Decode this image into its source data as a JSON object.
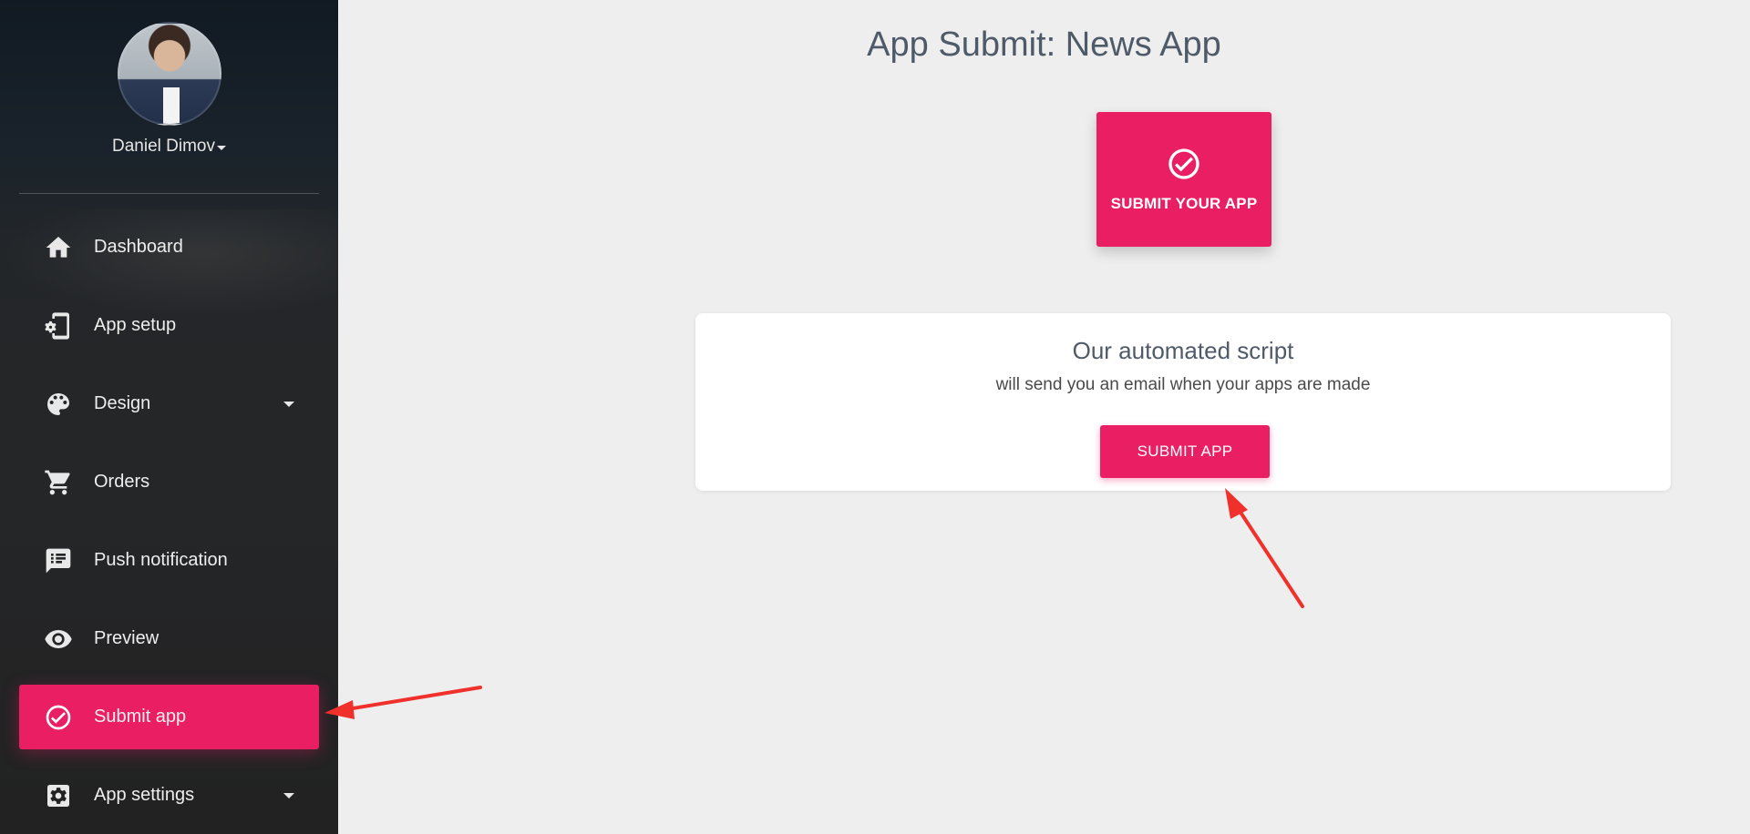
{
  "user": {
    "name": "Daniel Dimov"
  },
  "sidebar": {
    "items": [
      {
        "label": "Dashboard",
        "icon": "home-icon"
      },
      {
        "label": "App setup",
        "icon": "phone-settings-icon"
      },
      {
        "label": "Design",
        "icon": "palette-icon"
      },
      {
        "label": "Orders",
        "icon": "cart-icon"
      },
      {
        "label": "Push notification",
        "icon": "message-icon"
      },
      {
        "label": "Preview",
        "icon": "eye-icon"
      },
      {
        "label": "Submit app",
        "icon": "check-circle-icon"
      },
      {
        "label": "App settings",
        "icon": "settings-icon"
      }
    ]
  },
  "main": {
    "title": "App Submit: News App",
    "submit_tile_label": "SUBMIT YOUR APP",
    "card": {
      "title": "Our automated script",
      "subtitle": "will send you an email when your apps are made",
      "button_label": "SUBMIT APP"
    }
  },
  "colors": {
    "accent": "#e91e63",
    "sidebar_bg": "#252628",
    "page_bg": "#eeeeee",
    "annotation_arrow": "#f0302a"
  }
}
